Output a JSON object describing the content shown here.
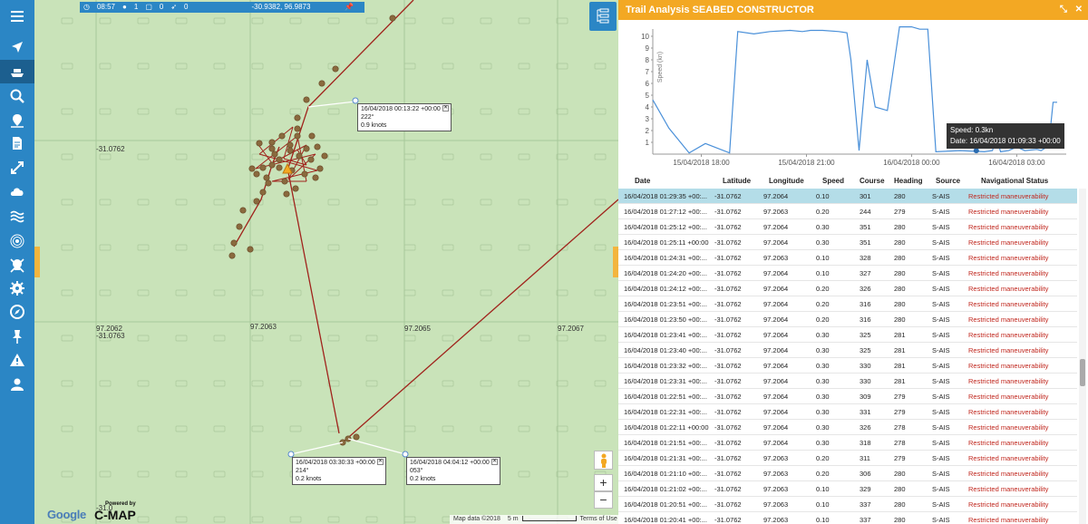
{
  "sidebar": {
    "items": [
      {
        "name": "menu-icon"
      },
      {
        "name": "navigation-arrow-icon"
      },
      {
        "name": "ship-icon"
      },
      {
        "name": "search-icon"
      },
      {
        "name": "location-icon"
      },
      {
        "name": "document-icon"
      },
      {
        "name": "expand-icon"
      },
      {
        "name": "cloud-icon"
      },
      {
        "name": "waves-icon"
      },
      {
        "name": "radar-icon"
      },
      {
        "name": "skull-icon"
      },
      {
        "name": "settings-icon"
      },
      {
        "name": "compass-icon"
      },
      {
        "name": "pin-icon"
      },
      {
        "name": "warning-icon"
      },
      {
        "name": "user-icon"
      }
    ]
  },
  "map": {
    "topbar": {
      "time": "08:57",
      "count1": "1",
      "count2": "0",
      "count3": "0",
      "coords": "-30.9382, 96.9873"
    },
    "lat_labels": [
      "-31.0762",
      "-31.0763"
    ],
    "lon_labels": [
      "97.2062",
      "97.2063",
      "97.2065",
      "97.2067"
    ],
    "bottom_label": "-31.0",
    "popups": [
      {
        "time": "16/04/2018 00:13:22 +00:00",
        "course": "222°",
        "speed": "0.9 knots"
      },
      {
        "time": "16/04/2018 03:30:33 +00:00",
        "course": "214°",
        "speed": "0.2 knots"
      },
      {
        "time": "16/04/2018 04:04:12 +00:00",
        "course": "053°",
        "speed": "0.2 knots"
      }
    ],
    "attribution": {
      "map_data": "Map data ©2018",
      "scale": "5 m",
      "terms": "Terms of Use"
    },
    "google": "Google",
    "cmap": "C-MAP",
    "powered_by": "Powered by",
    "zoom_in": "+",
    "zoom_out": "−"
  },
  "panel": {
    "title": "Trail Analysis SEABED CONSTRUCTOR",
    "controls": {
      "expand": "⤡",
      "close": "✕"
    },
    "tooltip": {
      "speed": "Speed: 0.3kn",
      "date": "Date: 16/04/2018 01:09:33 +00:00"
    },
    "headers": [
      "Date",
      "Latitude",
      "Longitude",
      "Speed",
      "Course",
      "Heading",
      "Source",
      "Navigational Status"
    ],
    "rows": [
      [
        "16/04/2018 01:29:35 +00:...",
        "-31.0762",
        "97.2064",
        "0.10",
        "301",
        "280",
        "S-AIS",
        "Restricted maneuverability"
      ],
      [
        "16/04/2018 01:27:12 +00:...",
        "-31.0762",
        "97.2063",
        "0.20",
        "244",
        "279",
        "S-AIS",
        "Restricted maneuverability"
      ],
      [
        "16/04/2018 01:25:12 +00:...",
        "-31.0762",
        "97.2064",
        "0.30",
        "351",
        "280",
        "S-AIS",
        "Restricted maneuverability"
      ],
      [
        "16/04/2018 01:25:11 +00:00",
        "-31.0762",
        "97.2064",
        "0.30",
        "351",
        "280",
        "S-AIS",
        "Restricted maneuverability"
      ],
      [
        "16/04/2018 01:24:31 +00:...",
        "-31.0762",
        "97.2063",
        "0.10",
        "328",
        "280",
        "S-AIS",
        "Restricted maneuverability"
      ],
      [
        "16/04/2018 01:24:20 +00:...",
        "-31.0762",
        "97.2064",
        "0.10",
        "327",
        "280",
        "S-AIS",
        "Restricted maneuverability"
      ],
      [
        "16/04/2018 01:24:12 +00:...",
        "-31.0762",
        "97.2064",
        "0.20",
        "326",
        "280",
        "S-AIS",
        "Restricted maneuverability"
      ],
      [
        "16/04/2018 01:23:51 +00:...",
        "-31.0762",
        "97.2064",
        "0.20",
        "316",
        "280",
        "S-AIS",
        "Restricted maneuverability"
      ],
      [
        "16/04/2018 01:23:50 +00:...",
        "-31.0762",
        "97.2064",
        "0.20",
        "316",
        "280",
        "S-AIS",
        "Restricted maneuverability"
      ],
      [
        "16/04/2018 01:23:41 +00:...",
        "-31.0762",
        "97.2064",
        "0.30",
        "325",
        "281",
        "S-AIS",
        "Restricted maneuverability"
      ],
      [
        "16/04/2018 01:23:40 +00:...",
        "-31.0762",
        "97.2064",
        "0.30",
        "325",
        "281",
        "S-AIS",
        "Restricted maneuverability"
      ],
      [
        "16/04/2018 01:23:32 +00:...",
        "-31.0762",
        "97.2064",
        "0.30",
        "330",
        "281",
        "S-AIS",
        "Restricted maneuverability"
      ],
      [
        "16/04/2018 01:23:31 +00:...",
        "-31.0762",
        "97.2064",
        "0.30",
        "330",
        "281",
        "S-AIS",
        "Restricted maneuverability"
      ],
      [
        "16/04/2018 01:22:51 +00:...",
        "-31.0762",
        "97.2064",
        "0.30",
        "309",
        "279",
        "S-AIS",
        "Restricted maneuverability"
      ],
      [
        "16/04/2018 01:22:31 +00:...",
        "-31.0762",
        "97.2064",
        "0.30",
        "331",
        "279",
        "S-AIS",
        "Restricted maneuverability"
      ],
      [
        "16/04/2018 01:22:11 +00:00",
        "-31.0762",
        "97.2064",
        "0.30",
        "326",
        "278",
        "S-AIS",
        "Restricted maneuverability"
      ],
      [
        "16/04/2018 01:21:51 +00:...",
        "-31.0762",
        "97.2064",
        "0.30",
        "318",
        "278",
        "S-AIS",
        "Restricted maneuverability"
      ],
      [
        "16/04/2018 01:21:31 +00:...",
        "-31.0762",
        "97.2063",
        "0.20",
        "311",
        "279",
        "S-AIS",
        "Restricted maneuverability"
      ],
      [
        "16/04/2018 01:21:10 +00:...",
        "-31.0762",
        "97.2063",
        "0.20",
        "306",
        "280",
        "S-AIS",
        "Restricted maneuverability"
      ],
      [
        "16/04/2018 01:21:02 +00:...",
        "-31.0762",
        "97.2063",
        "0.10",
        "329",
        "280",
        "S-AIS",
        "Restricted maneuverability"
      ],
      [
        "16/04/2018 01:20:51 +00:...",
        "-31.0762",
        "97.2063",
        "0.10",
        "337",
        "280",
        "S-AIS",
        "Restricted maneuverability"
      ],
      [
        "16/04/2018 01:20:41 +00:...",
        "-31.0762",
        "97.2063",
        "0.10",
        "337",
        "280",
        "S-AIS",
        "Restricted maneuverability"
      ]
    ]
  },
  "chart_data": {
    "type": "line",
    "ylabel": "Speed (kn)",
    "ylim": [
      0,
      10
    ],
    "yticks": [
      1,
      2,
      3,
      4,
      5,
      6,
      7,
      8,
      9,
      10
    ],
    "xticks": [
      "15/04/2018 18:00",
      "15/04/2018 21:00",
      "16/04/2018 00:00",
      "16/04/2018 03:00"
    ],
    "series": [
      {
        "values": [
          [
            0.0,
            4.6
          ],
          [
            0.04,
            2.2
          ],
          [
            0.09,
            0.1
          ],
          [
            0.13,
            0.9
          ],
          [
            0.19,
            0.1
          ],
          [
            0.21,
            10.4
          ],
          [
            0.25,
            10.2
          ],
          [
            0.29,
            10.4
          ],
          [
            0.34,
            10.5
          ],
          [
            0.37,
            10.4
          ],
          [
            0.39,
            10.5
          ],
          [
            0.42,
            10.5
          ],
          [
            0.46,
            10.4
          ],
          [
            0.48,
            10.3
          ],
          [
            0.49,
            8.0
          ],
          [
            0.51,
            0.3
          ],
          [
            0.53,
            8.0
          ],
          [
            0.55,
            4.0
          ],
          [
            0.58,
            3.7
          ],
          [
            0.61,
            10.8
          ],
          [
            0.64,
            10.8
          ],
          [
            0.66,
            10.6
          ],
          [
            0.68,
            10.6
          ],
          [
            0.7,
            0.2
          ],
          [
            0.76,
            0.3
          ],
          [
            0.82,
            0.2
          ],
          [
            0.84,
            0.3
          ],
          [
            0.85,
            1.4
          ],
          [
            0.86,
            0.2
          ],
          [
            0.88,
            0.3
          ],
          [
            0.9,
            0.6
          ],
          [
            0.92,
            0.3
          ],
          [
            0.95,
            0.4
          ],
          [
            0.96,
            0.3
          ],
          [
            0.97,
            0.5
          ],
          [
            0.98,
            1.1
          ],
          [
            0.99,
            4.4
          ],
          [
            1.0,
            4.4
          ]
        ]
      }
    ],
    "grid": false,
    "color": "#4a90d9"
  }
}
